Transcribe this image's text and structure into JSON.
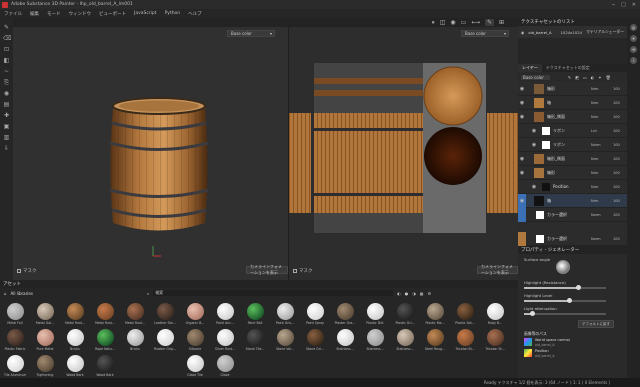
{
  "window": {
    "title": "Adobe Substance 3D Painter - lhp_old_barrel_A_lm001"
  },
  "menubar": {
    "items": [
      "ファイル",
      "編集",
      "モード",
      "ウィンドウ",
      "ビューポート",
      "JavaScript",
      "Python",
      "ヘルプ"
    ]
  },
  "viewport": {
    "mode_3d": "Base color",
    "mode_2d": "Base color",
    "label_3d": "マスク",
    "label_2d": "マスク",
    "button_3d": "カメラインフォメーションを表示",
    "button_2d": "カメラインフォメーションを表示"
  },
  "right_panel": {
    "texture_set_list_title": "テクスチャセットのリスト",
    "texture_set": {
      "name": "old_barrel_A",
      "resolution": "1024x1024",
      "shader": "マテリアルシェーダー"
    },
    "layers_tab": "レイヤー",
    "texture_set_settings_tab": "テクスチャセットの設定",
    "blend_mode": "Base color",
    "layers": [
      {
        "name": "箱形",
        "blend": "Nrm",
        "opacity": "100"
      },
      {
        "name": "箱",
        "blend": "Nrm",
        "opacity": "100"
      },
      {
        "name": "箱形_側面",
        "blend": "Nrm",
        "opacity": "100"
      },
      {
        "name": "リボン",
        "blend": "Lrd",
        "opacity": "100"
      },
      {
        "name": "リボン",
        "blend": "Norm",
        "opacity": "100"
      },
      {
        "name": "箱形_側面",
        "blend": "Nrm",
        "opacity": "100"
      },
      {
        "name": "箱形",
        "blend": "Nrm",
        "opacity": "100"
      },
      {
        "name": "Position",
        "blend": "Nrm",
        "opacity": "100"
      },
      {
        "name": "箱",
        "blend": "Nrm",
        "opacity": "100"
      },
      {
        "name": "カラー選択",
        "blend": "Norm",
        "opacity": "100"
      },
      {
        "name": "カラー選択",
        "blend": "Norm",
        "opacity": "100"
      }
    ],
    "properties_title": "プロパティ - ジェネレーター",
    "props": {
      "surface": "Surface angle",
      "light_resistance": "Highlight (Resistance)",
      "light_level": "Highlight Level",
      "light_attenuation": "Light attenuation",
      "reset": "デフォルトに戻す",
      "section2": "画像等のパス",
      "item1": "World space normal",
      "item1_sub": "old_barrel_A",
      "item2": "Position",
      "item2_sub": "old_barrel_A"
    }
  },
  "shelf": {
    "title": "アセット",
    "breadcrumb": "All libraries",
    "search_placeholder": "検索",
    "materials": [
      [
        "Metal Foil",
        "Metal Gal...",
        "Metal Rust...",
        "Metal Rust...",
        "Metal Rust...",
        "Leather Ste...",
        "Organic B...",
        "Paint Anc...",
        "Paint Ball",
        "Paint Gris...",
        "Paint Spray",
        "Plaster Gra...",
        "Plastic Dirt",
        "Plastic Gri...",
        "Plastic Ma...",
        "Plastic Sot...",
        "Ruby B..."
      ],
      [
        "Plastic Fabric",
        "Pure Metal",
        "Bricks",
        "Rope Natu...",
        "Bricks",
        "Rubber Grip...",
        "Silicone",
        "Silver Rust...",
        "Stone Tile...",
        "Stone Vol...",
        "Stone Gri...",
        "Stainless...",
        "Stainless...",
        "Stainless...",
        "Steel Roug...",
        "Tricolon Bl...",
        "Tricolon St..."
      ],
      [
        "Tile Aluminum...",
        "Tightening",
        "Wood Bark",
        "Wood Bark",
        "",
        "",
        "Glaze Tile",
        "Glaze",
        "",
        "",
        "",
        "",
        "",
        "",
        "",
        "",
        ""
      ]
    ]
  },
  "status": {
    "text": "Ready テクスチャ 1/2 個を表示: 3 (64 ノード ) 1: 1 ( 0 Elements )"
  },
  "colors": {
    "accent": "#3b6fb6",
    "panel": "#2a2a2a",
    "viewport": "#303030"
  }
}
